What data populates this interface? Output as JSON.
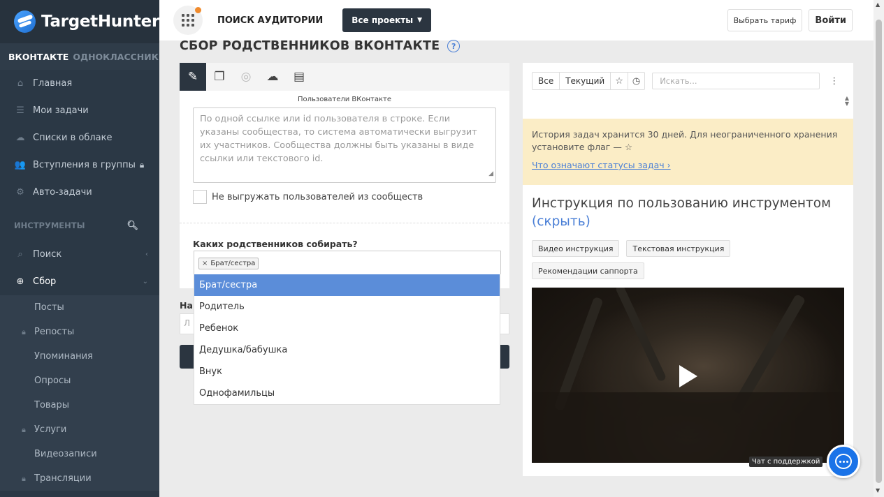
{
  "brand": {
    "name": "TargetHunter"
  },
  "networks": [
    {
      "label": "ВКОНТАКТЕ",
      "active": true
    },
    {
      "label": "ОДНОКЛАССНИКИ",
      "active": false
    }
  ],
  "nav": [
    {
      "label": "Главная",
      "icon": "home-icon"
    },
    {
      "label": "Мои задачи",
      "icon": "list-icon"
    },
    {
      "label": "Списки в облаке",
      "icon": "cloud-icon"
    },
    {
      "label": "Вступления в группы",
      "icon": "users-icon",
      "locked": true
    },
    {
      "label": "Авто-задачи",
      "icon": "gears-icon"
    }
  ],
  "tools_section": {
    "label": "ИНСТРУМЕНТЫ"
  },
  "tools": [
    {
      "label": "Поиск",
      "icon": "search-icon"
    },
    {
      "label": "Сбор",
      "icon": "zoom-plus-icon",
      "active": true
    }
  ],
  "collect_items": [
    {
      "label": "Посты",
      "locked": false
    },
    {
      "label": "Репосты",
      "locked": true
    },
    {
      "label": "Упоминания",
      "locked": false
    },
    {
      "label": "Опросы",
      "locked": false
    },
    {
      "label": "Товары",
      "locked": false
    },
    {
      "label": "Услуги",
      "locked": true
    },
    {
      "label": "Видеозаписи",
      "locked": false
    },
    {
      "label": "Трансляции",
      "locked": true
    }
  ],
  "topbar": {
    "title": "ПОИСК АУДИТОРИИ",
    "projects": "Все проекты",
    "tariff": "Выбрать тариф",
    "login": "Войти"
  },
  "page": {
    "title": "СБОР РОДСТВЕННИКОВ ВКОНТАКТЕ",
    "help": "?"
  },
  "form": {
    "field_label": "Пользователи ВКонтакте",
    "textarea_placeholder": "По одной ссылке или id пользователя в строке. Если указаны сообщества, то система автоматически выгрузит их участников. Сообщества должны быть указаны в виде ссылки или текстового id.",
    "checkbox_label": "Не выгружать пользователей из сообществ",
    "relatives_label": "Каких родственников собирать?",
    "selected_tag": "Брат/сестра",
    "name_label_partial": "На",
    "name_input_partial": "Л"
  },
  "dropdown": {
    "options": [
      "Брат/сестра",
      "Родитель",
      "Ребенок",
      "Дедушка/бабушка",
      "Внук",
      "Однофамильцы"
    ],
    "highlighted": 0
  },
  "history": {
    "filter_all": "Все",
    "filter_current": "Текущий",
    "search_placeholder": "Искать...",
    "notice": "История задач хранится 30 дней. Для неограниченного хранения установите флаг — ☆",
    "notice_link": "Что означают статусы задач ›"
  },
  "instructions": {
    "title": "Инструкция по пользованию инструментом",
    "hide": "(скрыть)",
    "buttons": [
      "Видео инструкция",
      "Текстовая инструкция",
      "Рекомендации саппорта"
    ]
  },
  "support": {
    "label": "Чат с поддержкой"
  },
  "colors": {
    "sidebar": "#2b3845",
    "accent": "#4a7fd6",
    "highlight": "#5b8dd9",
    "notice": "#fbedc6",
    "dark_button": "#2b3540",
    "badge": "#f08a2c"
  }
}
